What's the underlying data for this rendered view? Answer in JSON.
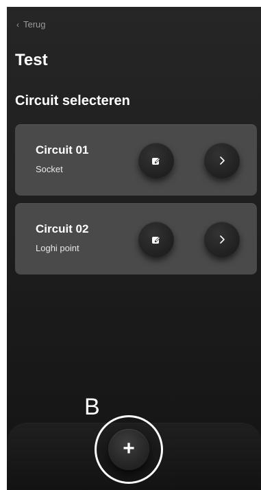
{
  "header": {
    "back_label": "Terug",
    "title": "Test"
  },
  "section": {
    "title": "Circuit selecteren"
  },
  "circuits": [
    {
      "name": "Circuit 01",
      "type": "Socket"
    },
    {
      "name": "Circuit 02",
      "type": "Loghi point"
    }
  ],
  "icons": {
    "back": "chevron-left-icon",
    "edit": "edit-icon",
    "next": "chevron-right-icon",
    "add": "plus-icon"
  },
  "footer": {
    "add_label": "+"
  },
  "annotation": {
    "label": "B"
  },
  "colors": {
    "background": "#1c1c1c",
    "card": "#4a4a4a",
    "button": "#202020",
    "text": "#ffffff",
    "muted": "#9a9a9a",
    "annotation": "#ffffff"
  }
}
